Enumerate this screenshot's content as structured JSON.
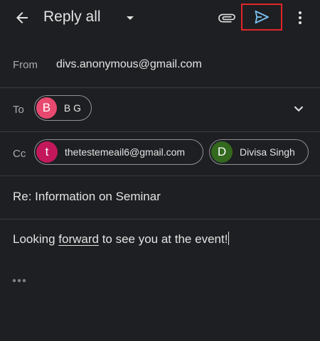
{
  "header": {
    "title": "Reply all",
    "icons": {
      "back": "arrow-back-icon",
      "dropdown": "caret-down-icon",
      "attach": "paperclip-icon",
      "send": "send-icon",
      "more": "more-vert-icon"
    }
  },
  "from": {
    "label": "From",
    "value": "divs.anonymous@gmail.com"
  },
  "to": {
    "label": "To",
    "recipients": [
      {
        "initial": "B",
        "name": "B G",
        "color": "#e8496f"
      }
    ]
  },
  "cc": {
    "label": "Cc",
    "recipients": [
      {
        "initial": "t",
        "name": "thetestemeail6@gmail.com",
        "color": "#c2185b"
      },
      {
        "initial": "D",
        "name": "Divisa Singh",
        "color": "#33691e"
      }
    ]
  },
  "subject": "Re: Information on Seminar",
  "body": {
    "before": "Looking ",
    "underlined": "forward",
    "after": " to see you at the event!"
  },
  "colors": {
    "background": "#1e1f22",
    "send_accent": "#7cc4f5",
    "highlight_box": "#e3262a"
  }
}
